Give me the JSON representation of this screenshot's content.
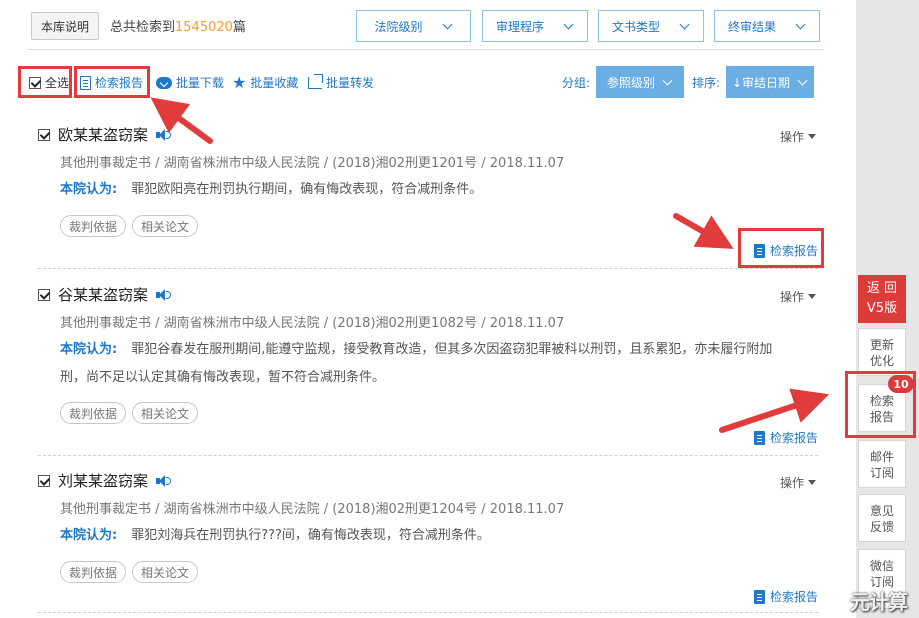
{
  "topbar": {
    "lib_button": "本库说明",
    "total_prefix": "总共检索到",
    "total_count": "1545020",
    "total_suffix": "篇",
    "filters": [
      "法院级别",
      "审理程序",
      "文书类型",
      "终审结果"
    ]
  },
  "toolbar": {
    "select_all": "全选",
    "report": "检索报告",
    "batch_download": "批量下载",
    "batch_favorite": "批量收藏",
    "batch_forward": "批量转发",
    "group_label": "分组:",
    "group_value": "参照级别",
    "sort_label": "排序:",
    "sort_value": "↓审结日期"
  },
  "results": [
    {
      "title": "欧某某盗窃案",
      "meta": "其他刑事裁定书 / 湖南省株洲市中级人民法院 / (2018)湘02刑更1201号 / 2018.11.07",
      "holding_label": "本院认为:",
      "holding": "罪犯欧阳亮在刑罚执行期间，确有悔改表现，符合减刑条件。",
      "tags": [
        "裁判依据",
        "相关论文"
      ],
      "op": "操作",
      "report": "检索报告"
    },
    {
      "title": "谷某某盗窃案",
      "meta": "其他刑事裁定书 / 湖南省株洲市中级人民法院 / (2018)湘02刑更1082号 / 2018.11.07",
      "holding_label": "本院认为:",
      "holding": "罪犯谷春发在服刑期间,能遵守监规，接受教育改造，但其多次因盗窃犯罪被科以刑罚，且系累犯，亦未履行附加刑，尚不足以认定其确有悔改表现，暂不符合减刑条件。",
      "tags": [
        "裁判依据",
        "相关论文"
      ],
      "op": "操作",
      "report": "检索报告"
    },
    {
      "title": "刘某某盗窃案",
      "meta": "其他刑事裁定书 / 湖南省株洲市中级人民法院 / (2018)湘02刑更1204号 / 2018.11.07",
      "holding_label": "本院认为:",
      "holding": "罪犯刘海兵在刑罚执行???间，确有悔改表现，符合减刑条件。",
      "tags": [
        "裁判依据",
        "相关论文"
      ],
      "op": "操作",
      "report": "检索报告"
    }
  ],
  "sidebar": {
    "return_v5_line1": "返 回",
    "return_v5_line2": "V5版",
    "update_line1": "更新",
    "update_line2": "优化",
    "report_line1": "检索",
    "report_line2": "报告",
    "report_badge": "10",
    "mail_line1": "邮件",
    "mail_line2": "订阅",
    "feedback_line1": "意见",
    "feedback_line2": "反馈",
    "wechat_line1": "微信",
    "wechat_line2": "订阅"
  },
  "watermark": "元计算",
  "colors": {
    "accent": "#1f78c8",
    "highlight": "#e23b3b",
    "count": "#f39a3b",
    "group_button": "#6aaee3"
  }
}
